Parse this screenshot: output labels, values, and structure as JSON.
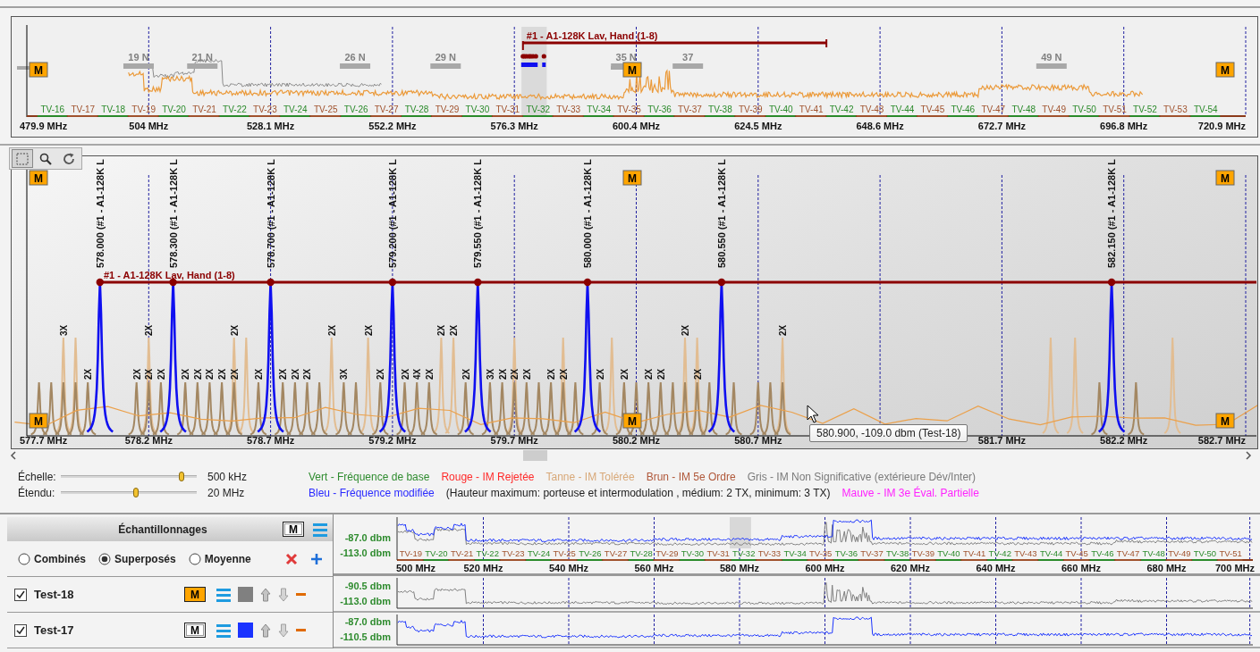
{
  "overview": {
    "band": {
      "label": "#1 - A1-128K Lav, Hand (1-8)"
    },
    "channel_badges": [
      "19 N",
      "21 N",
      "26 N",
      "29 N",
      "35 N",
      "37",
      "49 N"
    ],
    "markers": [
      "M",
      "M",
      "M"
    ],
    "tv_channels": [
      {
        "label": "TV-16",
        "color": "#2a8a2a"
      },
      {
        "label": "TV-17",
        "color": "#a0522d"
      },
      {
        "label": "TV-18",
        "color": "#2a8a2a"
      },
      {
        "label": "TV-19",
        "color": "#a0522d"
      },
      {
        "label": "TV-20",
        "color": "#2a8a2a"
      },
      {
        "label": "TV-21",
        "color": "#a0522d"
      },
      {
        "label": "TV-22",
        "color": "#2a8a2a"
      },
      {
        "label": "TV-23",
        "color": "#a0522d"
      },
      {
        "label": "TV-24",
        "color": "#2a8a2a"
      },
      {
        "label": "TV-25",
        "color": "#a0522d"
      },
      {
        "label": "TV-26",
        "color": "#2a8a2a"
      },
      {
        "label": "TV-27",
        "color": "#a0522d"
      },
      {
        "label": "TV-28",
        "color": "#2a8a2a"
      },
      {
        "label": "TV-29",
        "color": "#a0522d"
      },
      {
        "label": "TV-30",
        "color": "#2a8a2a"
      },
      {
        "label": "TV-31",
        "color": "#a0522d"
      },
      {
        "label": "TV-32",
        "color": "#2a8a2a"
      },
      {
        "label": "TV-33",
        "color": "#a0522d"
      },
      {
        "label": "TV-34",
        "color": "#2a8a2a"
      },
      {
        "label": "TV-35",
        "color": "#a0522d"
      },
      {
        "label": "TV-36",
        "color": "#2a8a2a"
      },
      {
        "label": "TV-37",
        "color": "#a0522d"
      },
      {
        "label": "TV-38",
        "color": "#2a8a2a"
      },
      {
        "label": "TV-39",
        "color": "#a0522d"
      },
      {
        "label": "TV-40",
        "color": "#2a8a2a"
      },
      {
        "label": "TV-41",
        "color": "#a0522d"
      },
      {
        "label": "TV-42",
        "color": "#2a8a2a"
      },
      {
        "label": "TV-43",
        "color": "#a0522d"
      },
      {
        "label": "TV-44",
        "color": "#2a8a2a"
      },
      {
        "label": "TV-45",
        "color": "#a0522d"
      },
      {
        "label": "TV-46",
        "color": "#2a8a2a"
      },
      {
        "label": "TV-47",
        "color": "#a0522d"
      },
      {
        "label": "TV-48",
        "color": "#2a8a2a"
      },
      {
        "label": "TV-49",
        "color": "#a0522d"
      },
      {
        "label": "TV-50",
        "color": "#2a8a2a"
      },
      {
        "label": "TV-51",
        "color": "#a0522d"
      },
      {
        "label": "TV-52",
        "color": "#2a8a2a"
      },
      {
        "label": "TV-53",
        "color": "#a0522d"
      },
      {
        "label": "TV-54",
        "color": "#2a8a2a"
      }
    ],
    "ticks": [
      "479.9 MHz",
      "504 MHz",
      "528.1 MHz",
      "552.2 MHz",
      "576.3 MHz",
      "600.4 MHz",
      "624.5 MHz",
      "648.6 MHz",
      "672.7 MHz",
      "696.8 MHz",
      "720.9 MHz"
    ]
  },
  "toolbar": [
    {
      "kind": "select",
      "selected": true
    },
    {
      "kind": "zoom",
      "selected": false
    },
    {
      "kind": "refresh",
      "selected": false
    }
  ],
  "main": {
    "group_label": "#1 - A1-128K Lav, Hand (1-8)",
    "carriers": [
      "578.000 (#1 - A1-128K L",
      "578.300 (#1 - A1-128K L",
      "578.700 (#1 - A1-128K L",
      "579.200 (#1 - A1-128K L",
      "579.550 (#1 - A1-128K L",
      "580.000 (#1 - A1-128K L",
      "580.550 (#1 - A1-128K L",
      "582.150 (#1 - A1-128K L"
    ],
    "intermod": [
      {
        "kind": "tanne",
        "label": "3X"
      },
      {
        "kind": "tanne"
      },
      {
        "kind": "tanne",
        "label": "2X"
      },
      {
        "kind": "tanne",
        "label": "2X"
      },
      {
        "kind": "tanne"
      },
      {
        "kind": "tanne",
        "label": "2X"
      },
      {
        "kind": "tanne",
        "label": "2X"
      },
      {
        "kind": "tanne",
        "label": "2X"
      },
      {
        "kind": "tanne",
        "label": "2X"
      },
      {
        "kind": "tanne"
      },
      {
        "kind": "tanne"
      },
      {
        "kind": "tanne"
      },
      {
        "kind": "tanne",
        "label": "2X"
      },
      {
        "kind": "tanne"
      },
      {
        "kind": "tanne",
        "label": "2X"
      },
      {
        "kind": "tanne"
      },
      {
        "kind": "tanne"
      },
      {
        "kind": "tanne"
      },
      {
        "kind": "brun"
      },
      {
        "kind": "brun"
      },
      {
        "kind": "brun"
      },
      {
        "kind": "brun"
      },
      {
        "kind": "brun",
        "label": "2X"
      },
      {
        "kind": "brun",
        "label": "2X"
      },
      {
        "kind": "brun",
        "label": "2X"
      },
      {
        "kind": "brun",
        "label": "2X"
      },
      {
        "kind": "brun",
        "label": "2X"
      },
      {
        "kind": "brun",
        "label": "2X"
      },
      {
        "kind": "brun",
        "label": "2X"
      },
      {
        "kind": "brun",
        "label": "2X"
      },
      {
        "kind": "brun",
        "label": "2X"
      },
      {
        "kind": "brun",
        "label": "2X"
      },
      {
        "kind": "brun",
        "label": "2X"
      },
      {
        "kind": "brun",
        "label": "2X"
      },
      {
        "kind": "brun",
        "label": "2X"
      },
      {
        "kind": "brun"
      },
      {
        "kind": "brun",
        "label": "3X"
      },
      {
        "kind": "brun"
      },
      {
        "kind": "brun",
        "label": "2X"
      },
      {
        "kind": "brun",
        "label": "2X"
      },
      {
        "kind": "brun",
        "label": "4X"
      },
      {
        "kind": "brun",
        "label": "2X"
      },
      {
        "kind": "brun",
        "label": "2X"
      },
      {
        "kind": "brun",
        "label": "3X"
      },
      {
        "kind": "brun",
        "label": "2X"
      },
      {
        "kind": "brun",
        "label": "2X"
      },
      {
        "kind": "brun",
        "label": "2X"
      },
      {
        "kind": "brun"
      },
      {
        "kind": "brun",
        "label": "2X"
      },
      {
        "kind": "brun",
        "label": "2X"
      },
      {
        "kind": "brun"
      },
      {
        "kind": "brun",
        "label": "2X"
      },
      {
        "kind": "brun",
        "label": "2X"
      },
      {
        "kind": "brun"
      },
      {
        "kind": "brun",
        "label": "2X"
      },
      {
        "kind": "brun",
        "label": "2X"
      },
      {
        "kind": "brun"
      },
      {
        "kind": "brun"
      },
      {
        "kind": "brun",
        "label": "2X"
      },
      {
        "kind": "brun"
      },
      {
        "kind": "brun"
      },
      {
        "kind": "brun"
      },
      {
        "kind": "brun"
      },
      {
        "kind": "brun"
      },
      {
        "kind": "brun"
      },
      {
        "kind": "brun"
      }
    ],
    "markers": [
      "M",
      "M",
      "M",
      "M",
      "M",
      "M"
    ],
    "ticks": [
      "577.7 MHz",
      "578.2 MHz",
      "578.7 MHz",
      "579.2 MHz",
      "579.7 MHz",
      "580.2 MHz",
      "580.7 MHz",
      "581.7 MHz",
      "582.2 MHz",
      "582.7 MHz"
    ],
    "tooltip": "580.900, -109.0 dbm (Test-18)"
  },
  "sliders": [
    {
      "label": "Échelle:",
      "level": 0.89,
      "reading": "500 kHz"
    },
    {
      "label": "Étendu:",
      "level": 0.55,
      "reading": "20 MHz"
    }
  ],
  "legend_rows": [
    {
      "items": [
        {
          "text": "Vert - Fréquence de base",
          "color": "#2e8b2e"
        },
        {
          "text": "Rouge - IM Rejetée",
          "color": "#ff2a2a"
        },
        {
          "text": "Tanne - IM Tolérée",
          "color": "#d8a878"
        },
        {
          "text": "Brun - IM 5e Ordre",
          "color": "#b0583a"
        },
        {
          "text": "Gris - IM Non Significative (extérieure Dév/Inter)",
          "color": "#7a7a7a"
        }
      ]
    },
    {
      "items": [
        {
          "text": "Bleu - Fréquence modifiée",
          "color": "#2a2aff"
        },
        {
          "text": "(Hauteur maximum: porteuse et intermodulation , médium: 2 TX, minimum: 3 TX)",
          "color": "#202020"
        },
        {
          "text": "Mauve - IM 3e Éval. Partielle",
          "color": "#ff22ff"
        }
      ]
    }
  ],
  "samples_panel": {
    "title": "Échantillonnages",
    "marker_button": "M",
    "modes": [
      {
        "label": "Combinés",
        "selected": false
      },
      {
        "label": "Superposés",
        "selected": true
      },
      {
        "label": "Moyenne",
        "selected": false
      }
    ],
    "combined": {
      "max": "-87.0 dbm",
      "min": "-113.0 dbm",
      "tv_channels": [
        {
          "label": "TV-19",
          "color": "#a0522d"
        },
        {
          "label": "TV-20",
          "color": "#2a8a2a"
        },
        {
          "label": "TV-21",
          "color": "#a0522d"
        },
        {
          "label": "TV-22",
          "color": "#2a8a2a"
        },
        {
          "label": "TV-23",
          "color": "#a0522d"
        },
        {
          "label": "TV-24",
          "color": "#2a8a2a"
        },
        {
          "label": "TV-25",
          "color": "#a0522d"
        },
        {
          "label": "TV-26",
          "color": "#2a8a2a"
        },
        {
          "label": "TV-27",
          "color": "#a0522d"
        },
        {
          "label": "TV-28",
          "color": "#2a8a2a"
        },
        {
          "label": "TV-29",
          "color": "#a0522d"
        },
        {
          "label": "TV-30",
          "color": "#2a8a2a"
        },
        {
          "label": "TV-31",
          "color": "#a0522d"
        },
        {
          "label": "TV-32",
          "color": "#2a8a2a"
        },
        {
          "label": "TV-33",
          "color": "#a0522d"
        },
        {
          "label": "TV-34",
          "color": "#2a8a2a"
        },
        {
          "label": "TV-35",
          "color": "#a0522d"
        },
        {
          "label": "TV-36",
          "color": "#2a8a2a"
        },
        {
          "label": "TV-37",
          "color": "#a0522d"
        },
        {
          "label": "TV-38",
          "color": "#2a8a2a"
        },
        {
          "label": "TV-39",
          "color": "#a0522d"
        },
        {
          "label": "TV-40",
          "color": "#2a8a2a"
        },
        {
          "label": "TV-41",
          "color": "#a0522d"
        },
        {
          "label": "TV-42",
          "color": "#2a8a2a"
        },
        {
          "label": "TV-43",
          "color": "#a0522d"
        },
        {
          "label": "TV-44",
          "color": "#2a8a2a"
        },
        {
          "label": "TV-45",
          "color": "#a0522d"
        },
        {
          "label": "TV-46",
          "color": "#2a8a2a"
        },
        {
          "label": "TV-47",
          "color": "#a0522d"
        },
        {
          "label": "TV-48",
          "color": "#2a8a2a"
        },
        {
          "label": "TV-49",
          "color": "#a0522d"
        },
        {
          "label": "TV-50",
          "color": "#2a8a2a"
        },
        {
          "label": "TV-51",
          "color": "#a0522d"
        }
      ],
      "ticks": [
        "500 MHz",
        "520 MHz",
        "540 MHz",
        "560 MHz",
        "580 MHz",
        "600 MHz",
        "620 MHz",
        "640 MHz",
        "660 MHz",
        "680 MHz",
        "700 MHz"
      ]
    }
  },
  "samples": [
    {
      "name": "Test-18",
      "checked": true,
      "marker_on": true,
      "marker": "M",
      "color": "#808080",
      "max": "-90.5 dbm",
      "min": "-113.0 dbm"
    },
    {
      "name": "Test-17",
      "checked": true,
      "marker_on": false,
      "marker": "M",
      "color": "#1a33ff",
      "max": "-87.0 dbm",
      "min": "-110.5 dbm"
    }
  ]
}
